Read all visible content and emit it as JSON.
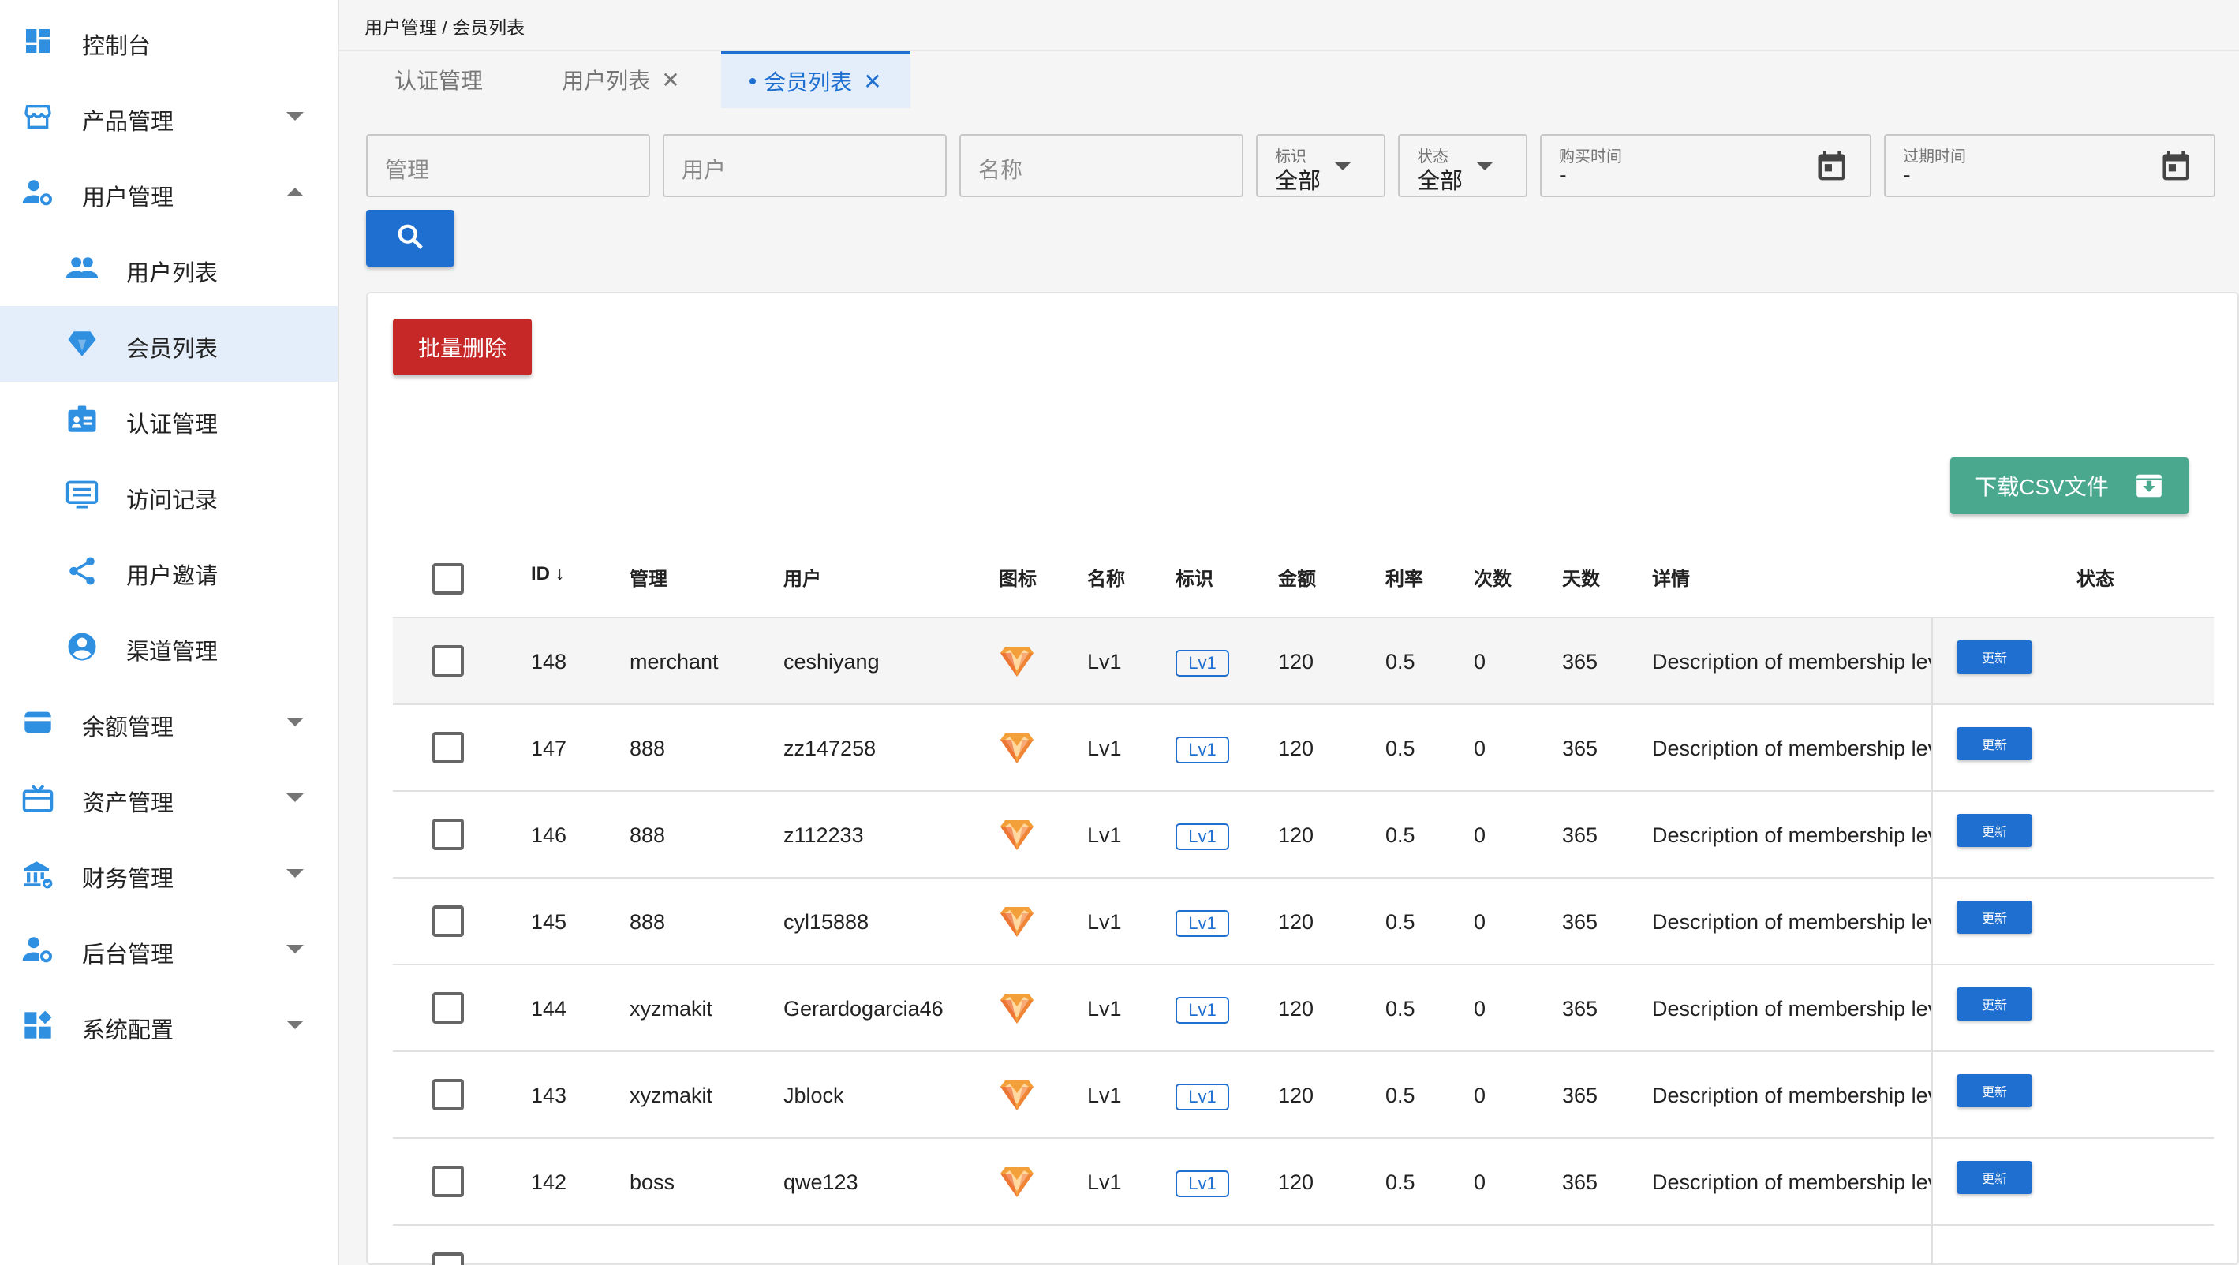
{
  "breadcrumb": "用户管理 / 会员列表",
  "sidebar": {
    "items": [
      {
        "label": "控制台",
        "icon": "dashboard-icon"
      },
      {
        "label": "产品管理",
        "icon": "store-icon"
      },
      {
        "label": "用户管理",
        "icon": "user-settings-icon"
      },
      {
        "label": "用户列表",
        "icon": "users-icon"
      },
      {
        "label": "会员列表",
        "icon": "diamond-icon"
      },
      {
        "label": "认证管理",
        "icon": "id-badge-icon"
      },
      {
        "label": "访问记录",
        "icon": "monitor-icon"
      },
      {
        "label": "用户邀请",
        "icon": "share-icon"
      },
      {
        "label": "渠道管理",
        "icon": "account-circle-icon"
      },
      {
        "label": "余额管理",
        "icon": "wallet-icon"
      },
      {
        "label": "资产管理",
        "icon": "gift-box-icon"
      },
      {
        "label": "财务管理",
        "icon": "bank-icon"
      },
      {
        "label": "后台管理",
        "icon": "admin-icon"
      },
      {
        "label": "系统配置",
        "icon": "widgets-icon"
      }
    ]
  },
  "tabs": [
    {
      "label": "认证管理"
    },
    {
      "label": "用户列表",
      "close": "✕"
    },
    {
      "label": "会员列表",
      "close": "✕"
    }
  ],
  "filters": {
    "manage_placeholder": "管理",
    "user_placeholder": "用户",
    "name_placeholder": "名称",
    "tag_label": "标识",
    "tag_value": "全部",
    "status_label": "状态",
    "status_value": "全部",
    "purchase_time_label": "购买时间",
    "purchase_time_value": "-",
    "expire_time_label": "过期时间",
    "expire_time_value": "-"
  },
  "actions": {
    "batch_delete": "批量删除",
    "download_csv": "下载CSV文件"
  },
  "table": {
    "headers": {
      "id": "ID",
      "sort_arrow": "↓",
      "manage": "管理",
      "user": "用户",
      "icon": "图标",
      "name": "名称",
      "tag": "标识",
      "amount": "金额",
      "rate": "利率",
      "times": "次数",
      "days": "天数",
      "detail": "详情",
      "status": "状态"
    },
    "rows": [
      {
        "id": "148",
        "manage": "merchant",
        "user": "ceshiyang",
        "name": "Lv1",
        "tag": "Lv1",
        "amount": "120",
        "rate": "0.5",
        "times": "0",
        "days": "365",
        "detail": "Description of membership lev",
        "action": "更新"
      },
      {
        "id": "147",
        "manage": "888",
        "user": "zz147258",
        "name": "Lv1",
        "tag": "Lv1",
        "amount": "120",
        "rate": "0.5",
        "times": "0",
        "days": "365",
        "detail": "Description of membership lev",
        "action": "更新"
      },
      {
        "id": "146",
        "manage": "888",
        "user": "z112233",
        "name": "Lv1",
        "tag": "Lv1",
        "amount": "120",
        "rate": "0.5",
        "times": "0",
        "days": "365",
        "detail": "Description of membership lev",
        "action": "更新"
      },
      {
        "id": "145",
        "manage": "888",
        "user": "cyl15888",
        "name": "Lv1",
        "tag": "Lv1",
        "amount": "120",
        "rate": "0.5",
        "times": "0",
        "days": "365",
        "detail": "Description of membership lev",
        "action": "更新"
      },
      {
        "id": "144",
        "manage": "xyzmakit",
        "user": "Gerardogarcia46",
        "name": "Lv1",
        "tag": "Lv1",
        "amount": "120",
        "rate": "0.5",
        "times": "0",
        "days": "365",
        "detail": "Description of membership lev",
        "action": "更新"
      },
      {
        "id": "143",
        "manage": "xyzmakit",
        "user": "Jblock",
        "name": "Lv1",
        "tag": "Lv1",
        "amount": "120",
        "rate": "0.5",
        "times": "0",
        "days": "365",
        "detail": "Description of membership lev",
        "action": "更新"
      },
      {
        "id": "142",
        "manage": "boss",
        "user": "qwe123",
        "name": "Lv1",
        "tag": "Lv1",
        "amount": "120",
        "rate": "0.5",
        "times": "0",
        "days": "365",
        "detail": "Description of membership lev",
        "action": "更新"
      }
    ]
  },
  "colors": {
    "primary": "#1f6fd1",
    "danger": "#c62828",
    "success": "#4aa88e",
    "sidebar_active": "#e3eefa"
  }
}
